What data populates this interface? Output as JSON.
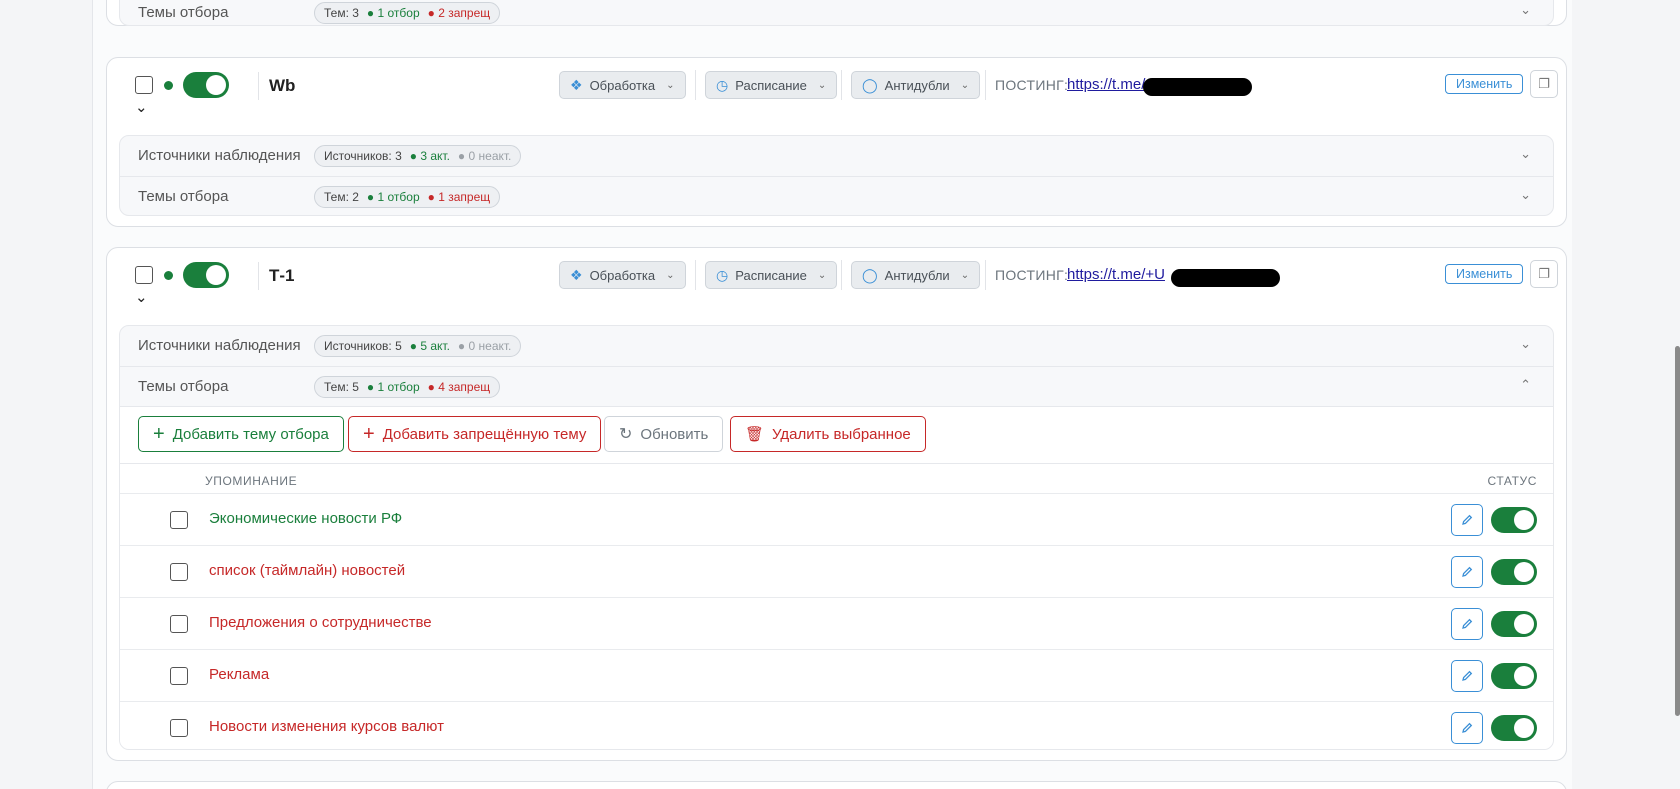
{
  "top_card": {
    "label": "Темы отбора",
    "topics_count": "Тем: 3",
    "selected": "● 1 отбор",
    "forbidden": "● 2 запрещ"
  },
  "channels": [
    {
      "name": "Wb",
      "buttons": {
        "processing": "Обработка",
        "schedule": "Расписание",
        "antidup": "Антидубли"
      },
      "posting_label": "ПОСТИНГ:",
      "posting_link": "https://t.me/",
      "edit_label": "Изменить",
      "sources": {
        "label": "Источники наблюдения",
        "count": "Источников: 3",
        "active": "● 3 акт.",
        "inactive": "● 0 неакт."
      },
      "topics": {
        "label": "Темы отбора",
        "count": "Тем: 2",
        "selected": "● 1 отбор",
        "forbidden": "● 1 запрещ"
      }
    },
    {
      "name": "Т-1",
      "buttons": {
        "processing": "Обработка",
        "schedule": "Расписание",
        "antidup": "Антидубли"
      },
      "posting_label": "ПОСТИНГ:",
      "posting_link": "https://t.me/+U",
      "edit_label": "Изменить",
      "sources": {
        "label": "Источники наблюдения",
        "count": "Источников: 5",
        "active": "● 5 акт.",
        "inactive": "● 0 неакт."
      },
      "topics": {
        "label": "Темы отбора",
        "count": "Тем: 5",
        "selected": "● 1 отбор",
        "forbidden": "● 4 запрещ"
      }
    }
  ],
  "topics_panel": {
    "add_topic": "Добавить тему отбора",
    "add_forbidden": "Добавить запрещённую тему",
    "refresh": "Обновить",
    "delete_selected": "Удалить выбранное",
    "col_mention": "УПОМИНАНИЕ",
    "col_status": "СТАТУС",
    "rows": [
      {
        "text": "Экономические новости РФ",
        "kind": "selected",
        "enabled": true
      },
      {
        "text": "список (таймлайн) новостей",
        "kind": "forbidden",
        "enabled": true
      },
      {
        "text": "Предложения о сотрудничестве",
        "kind": "forbidden",
        "enabled": true
      },
      {
        "text": "Реклама",
        "kind": "forbidden",
        "enabled": true
      },
      {
        "text": "Новости изменения курсов валют",
        "kind": "forbidden",
        "enabled": true
      }
    ]
  },
  "colors": {
    "green": "#1a7f3c",
    "red": "#c62828",
    "blue": "#3a8fd6"
  }
}
